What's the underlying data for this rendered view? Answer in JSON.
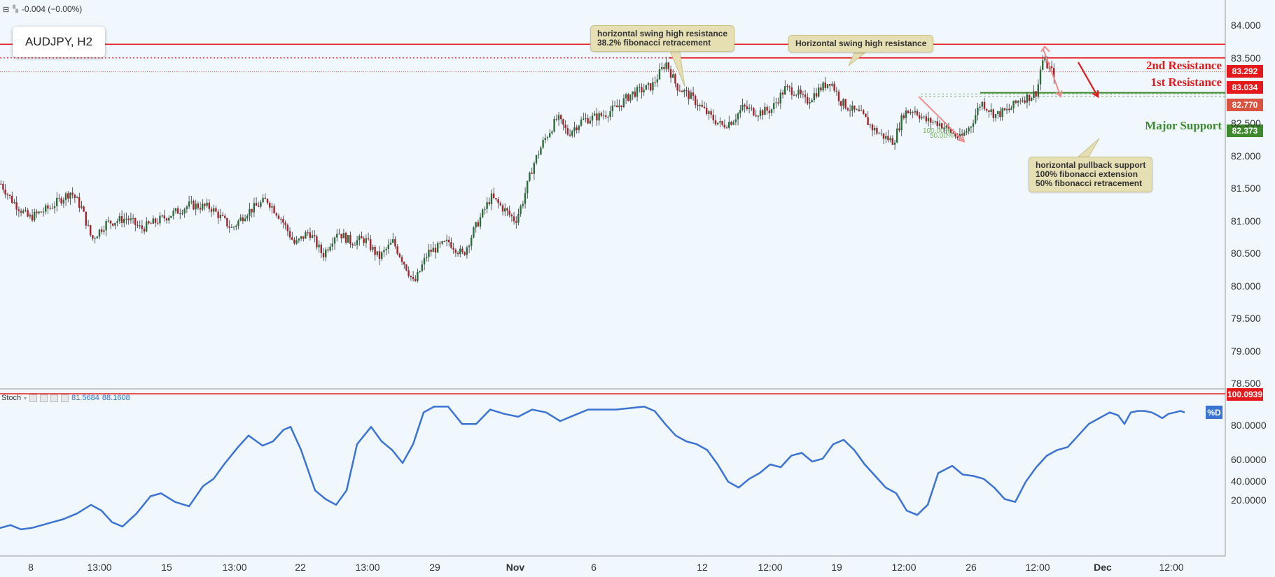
{
  "header": {
    "change_text": "-0.004 (−0.00%)"
  },
  "symbol": "AUDJPY, H2",
  "callouts": {
    "swing_fib": [
      "horizontal swing high resistance",
      "38.2% fibonacci retracement"
    ],
    "swing": "Horizontal swing high resistance",
    "pullback": [
      "horizontal pullback support",
      "100% fibonacci extension",
      "50% fibonacci retracement"
    ]
  },
  "levels": {
    "res2": {
      "label": "2nd Resistance",
      "price": "83.292",
      "color": "#e5191c"
    },
    "res1": {
      "label": "1st Resistance",
      "price": "83.034",
      "color": "#e5191c"
    },
    "mid": {
      "price": "82.770",
      "color": "#d9533f"
    },
    "support": {
      "label": "Major Support",
      "price": "82.373",
      "color": "#3d8a2e"
    }
  },
  "fib_labels": [
    "100.00%",
    "50.00%"
  ],
  "stoch": {
    "name": "Stoch",
    "k": "81.5684",
    "d": "88.1608",
    "level_tag": "100.0939",
    "series_badge": "%D"
  },
  "chart_data": [
    {
      "type": "candlestick",
      "title": "AUDJPY, H2",
      "y_ticks": [
        "84.000",
        "83.500",
        "83.000",
        "82.500",
        "82.000",
        "81.500",
        "81.000",
        "80.500",
        "80.000",
        "79.500",
        "79.000",
        "78.500"
      ],
      "ylim": [
        78.45,
        84.15
      ],
      "x_ticks": [
        "8",
        "13:00",
        "15",
        "13:00",
        "22",
        "13:00",
        "29",
        "Nov",
        "6",
        "12",
        "12:00",
        "19",
        "12:00",
        "26",
        "12:00",
        "Dec",
        "12:00"
      ],
      "horizontal_levels": [
        83.292,
        83.034,
        82.77,
        82.373
      ],
      "close_anchors": [
        [
          0,
          80.65
        ],
        [
          15,
          80.35
        ],
        [
          40,
          80.0
        ],
        [
          70,
          80.2
        ],
        [
          100,
          80.5
        ],
        [
          115,
          80.2
        ],
        [
          130,
          79.6
        ],
        [
          150,
          79.9
        ],
        [
          180,
          80.0
        ],
        [
          200,
          79.8
        ],
        [
          240,
          80.05
        ],
        [
          270,
          80.25
        ],
        [
          300,
          80.2
        ],
        [
          330,
          79.8
        ],
        [
          350,
          80.1
        ],
        [
          380,
          80.35
        ],
        [
          400,
          80.0
        ],
        [
          420,
          79.5
        ],
        [
          440,
          79.75
        ],
        [
          460,
          79.3
        ],
        [
          480,
          79.75
        ],
        [
          500,
          79.55
        ],
        [
          520,
          79.6
        ],
        [
          540,
          79.25
        ],
        [
          560,
          79.55
        ],
        [
          580,
          79.05
        ],
        [
          590,
          78.75
        ],
        [
          610,
          79.35
        ],
        [
          640,
          79.55
        ],
        [
          660,
          79.3
        ],
        [
          675,
          79.75
        ],
        [
          700,
          80.4
        ],
        [
          720,
          80.15
        ],
        [
          735,
          79.95
        ],
        [
          745,
          80.3
        ],
        [
          760,
          81.0
        ],
        [
          775,
          81.45
        ],
        [
          795,
          81.9
        ],
        [
          810,
          81.6
        ],
        [
          830,
          81.85
        ],
        [
          860,
          81.95
        ],
        [
          880,
          82.1
        ],
        [
          900,
          82.35
        ],
        [
          930,
          82.5
        ],
        [
          950,
          82.95
        ],
        [
          965,
          82.5
        ],
        [
          985,
          82.3
        ],
        [
          1000,
          82.1
        ],
        [
          1015,
          81.9
        ],
        [
          1030,
          81.75
        ],
        [
          1045,
          81.85
        ],
        [
          1060,
          82.1
        ],
        [
          1080,
          82.0
        ],
        [
          1100,
          82.05
        ],
        [
          1120,
          82.45
        ],
        [
          1135,
          82.4
        ],
        [
          1150,
          82.2
        ],
        [
          1170,
          82.45
        ],
        [
          1185,
          82.6
        ],
        [
          1200,
          82.2
        ],
        [
          1215,
          82.05
        ],
        [
          1230,
          81.95
        ],
        [
          1245,
          81.7
        ],
        [
          1260,
          81.55
        ],
        [
          1275,
          81.45
        ],
        [
          1290,
          82.0
        ],
        [
          1305,
          82.05
        ],
        [
          1320,
          81.85
        ],
        [
          1340,
          81.8
        ],
        [
          1355,
          81.65
        ],
        [
          1370,
          81.5
        ],
        [
          1385,
          81.75
        ],
        [
          1400,
          82.2
        ],
        [
          1420,
          81.95
        ],
        [
          1440,
          82.05
        ],
        [
          1455,
          82.25
        ],
        [
          1470,
          82.3
        ],
        [
          1480,
          82.4
        ],
        [
          1487,
          83.0
        ],
        [
          1497,
          82.85
        ],
        [
          1505,
          82.7
        ]
      ],
      "annotation_arrows": [
        [
          1312,
          82.3,
          1377,
          81.45
        ],
        [
          1490,
          83.2,
          1515,
          82.3
        ],
        [
          1540,
          82.95,
          1568,
          82.3
        ]
      ]
    },
    {
      "type": "line",
      "title": "Stoch",
      "y_ticks": [
        "20.0000",
        "40.0000",
        "60.0000",
        "80.0000"
      ],
      "ylim": [
        0,
        104
      ],
      "series": [
        {
          "values": [
            [
              0,
              8
            ],
            [
              15,
              10
            ],
            [
              30,
              7
            ],
            [
              45,
              8
            ],
            [
              60,
              10
            ],
            [
              75,
              12
            ],
            [
              90,
              14
            ],
            [
              110,
              18
            ],
            [
              130,
              24
            ],
            [
              145,
              20
            ],
            [
              160,
              12
            ],
            [
              175,
              9
            ],
            [
              195,
              18
            ],
            [
              215,
              30
            ],
            [
              230,
              32
            ],
            [
              250,
              26
            ],
            [
              270,
              23
            ],
            [
              290,
              37
            ],
            [
              305,
              42
            ],
            [
              320,
              52
            ],
            [
              340,
              64
            ],
            [
              355,
              72
            ],
            [
              375,
              65
            ],
            [
              390,
              68
            ],
            [
              405,
              76
            ],
            [
              415,
              78
            ],
            [
              430,
              62
            ],
            [
              450,
              34
            ],
            [
              465,
              28
            ],
            [
              480,
              24
            ],
            [
              495,
              34
            ],
            [
              510,
              66
            ],
            [
              530,
              78
            ],
            [
              545,
              68
            ],
            [
              560,
              62
            ],
            [
              575,
              53
            ],
            [
              590,
              66
            ],
            [
              605,
              88
            ],
            [
              620,
              92
            ],
            [
              640,
              92
            ],
            [
              660,
              80
            ],
            [
              680,
              80
            ],
            [
              700,
              90
            ],
            [
              720,
              87
            ],
            [
              740,
              85
            ],
            [
              760,
              90
            ],
            [
              780,
              88
            ],
            [
              800,
              82
            ],
            [
              820,
              86
            ],
            [
              840,
              90
            ],
            [
              860,
              90
            ],
            [
              880,
              90
            ],
            [
              900,
              91
            ],
            [
              920,
              92
            ],
            [
              935,
              89
            ],
            [
              950,
              80
            ],
            [
              965,
              72
            ],
            [
              980,
              68
            ],
            [
              995,
              66
            ],
            [
              1010,
              62
            ],
            [
              1025,
              52
            ],
            [
              1040,
              40
            ],
            [
              1055,
              36
            ],
            [
              1070,
              42
            ],
            [
              1085,
              46
            ],
            [
              1100,
              52
            ],
            [
              1115,
              50
            ],
            [
              1130,
              58
            ],
            [
              1145,
              60
            ],
            [
              1160,
              54
            ],
            [
              1175,
              56
            ],
            [
              1190,
              66
            ],
            [
              1205,
              69
            ],
            [
              1220,
              62
            ],
            [
              1235,
              52
            ],
            [
              1250,
              44
            ],
            [
              1265,
              36
            ],
            [
              1280,
              32
            ],
            [
              1295,
              20
            ],
            [
              1310,
              17
            ],
            [
              1325,
              24
            ],
            [
              1340,
              46
            ],
            [
              1360,
              51
            ],
            [
              1375,
              45
            ],
            [
              1390,
              44
            ],
            [
              1405,
              42
            ],
            [
              1420,
              36
            ],
            [
              1435,
              28
            ],
            [
              1450,
              26
            ],
            [
              1465,
              40
            ],
            [
              1480,
              50
            ],
            [
              1495,
              58
            ],
            [
              1510,
              62
            ],
            [
              1525,
              64
            ],
            [
              1540,
              72
            ],
            [
              1555,
              80
            ],
            [
              1570,
              84
            ],
            [
              1585,
              88
            ],
            [
              1597,
              86
            ],
            [
              1606,
              80
            ],
            [
              1615,
              88
            ],
            [
              1625,
              89
            ],
            [
              1635,
              89
            ],
            [
              1645,
              88
            ],
            [
              1653,
              86
            ],
            [
              1660,
              84
            ],
            [
              1669,
              87
            ],
            [
              1678,
              88
            ],
            [
              1686,
              89
            ],
            [
              1692,
              88
            ]
          ]
        }
      ]
    }
  ]
}
